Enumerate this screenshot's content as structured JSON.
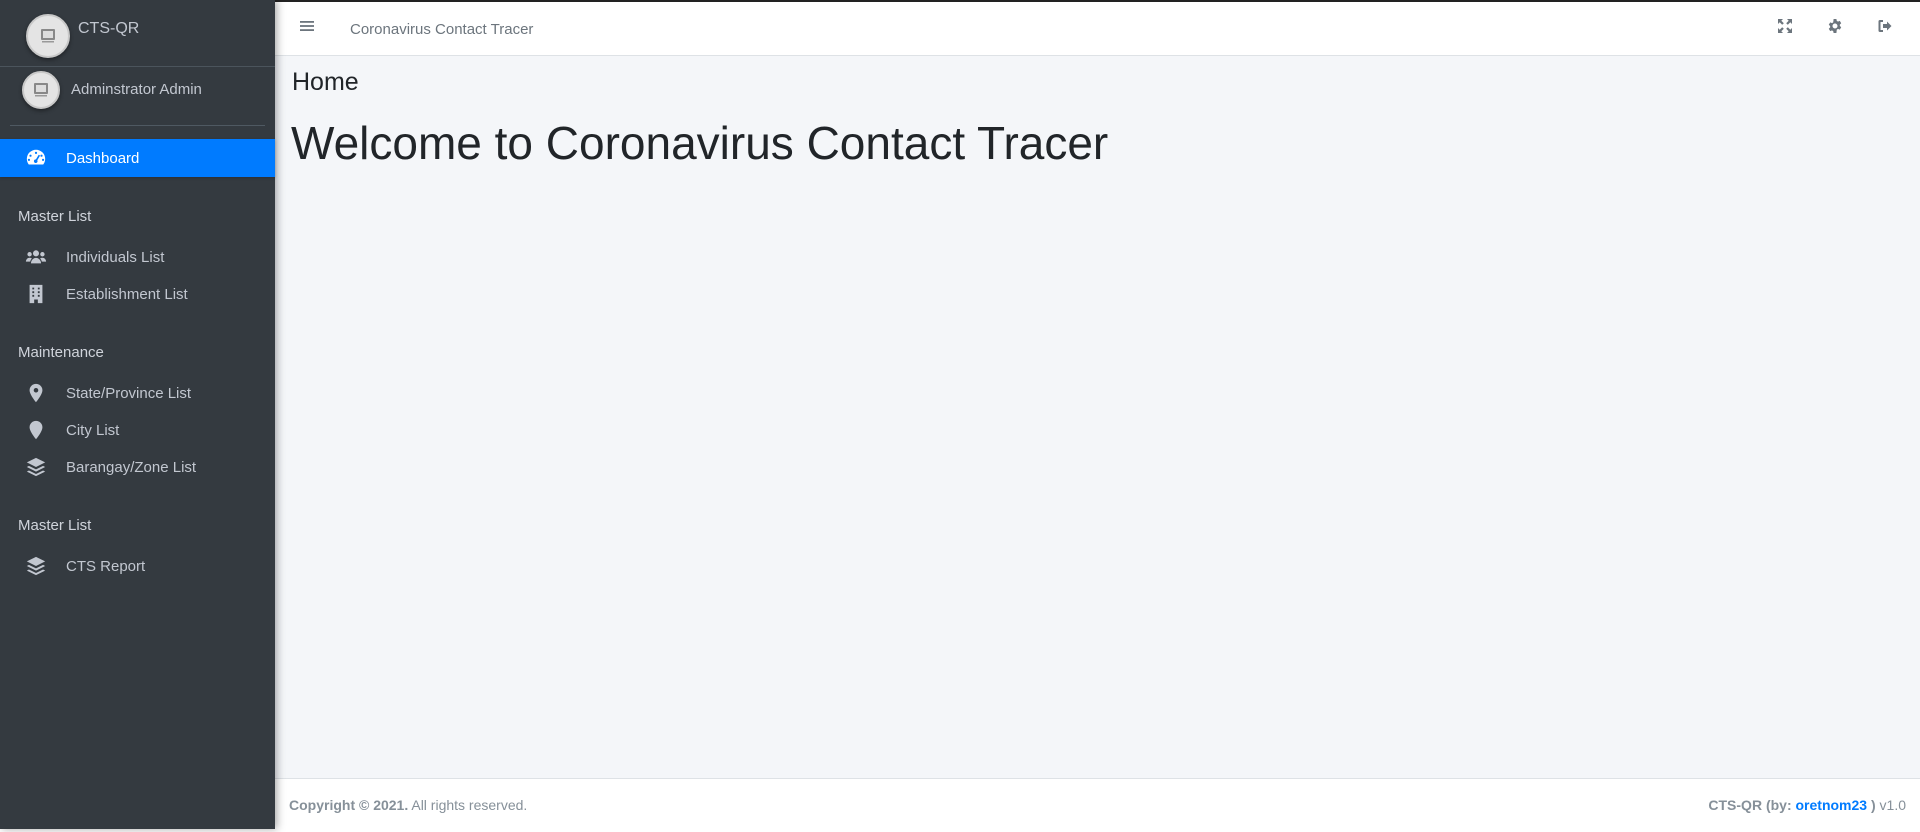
{
  "brand": {
    "name": "CTS-QR"
  },
  "user": {
    "name": "Adminstrator Admin"
  },
  "sidebar": {
    "dashboard": "Dashboard",
    "section1": "Master List",
    "individuals": "Individuals List",
    "establishment": "Establishment List",
    "section2": "Maintenance",
    "state": "State/Province List",
    "city": "City List",
    "barangay": "Barangay/Zone List",
    "section3": "Master List",
    "report": "CTS Report"
  },
  "topbar": {
    "title": "Coronavirus Contact Tracer"
  },
  "content": {
    "page_title": "Home",
    "welcome": "Welcome to Coronavirus Contact Tracer"
  },
  "footer": {
    "copyright": "Copyright © 2021.",
    "rights": " All rights reserved.",
    "app": "CTS-QR (by: ",
    "author": "oretnom23",
    "close": " )",
    "version": " v1.0"
  },
  "colors": {
    "sidebar": "#343a40",
    "active": "#007bff",
    "background": "#f4f6f9"
  },
  "icons": {
    "brand": "image-placeholder-icon",
    "dashboard": "tachometer-icon",
    "individuals": "users-icon",
    "establishment": "building-icon",
    "state": "map-marker-icon",
    "city": "map-pin-icon",
    "barangay": "layers-icon",
    "report": "layers-icon",
    "menu": "hamburger-icon",
    "fullscreen": "expand-icon",
    "settings": "gear-icon",
    "logout": "sign-out-icon"
  }
}
